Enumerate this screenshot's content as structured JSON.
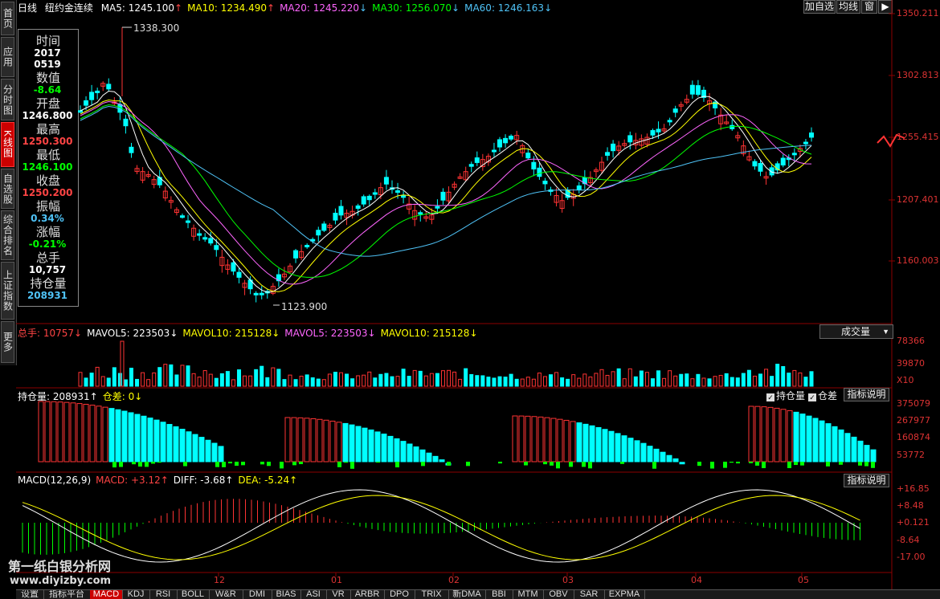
{
  "header": {
    "period": "日线",
    "instrument": "纽约金连续",
    "ma": [
      {
        "label": "MA5: 1245.100",
        "arrow": "↑",
        "color": "#ffffff"
      },
      {
        "label": "MA10: 1234.490",
        "arrow": "↑",
        "color": "#ffff00"
      },
      {
        "label": "MA20: 1245.220",
        "arrow": "↓",
        "color": "#ff66ff"
      },
      {
        "label": "MA30: 1256.070",
        "arrow": "↓",
        "color": "#00ff00"
      },
      {
        "label": "MA60: 1246.163",
        "arrow": "↓",
        "color": "#4fc3f7"
      }
    ],
    "buttons": {
      "add_watch": "加自选",
      "average": "均线",
      "window": "窗"
    }
  },
  "leftnav": [
    {
      "label": "首页",
      "active": false
    },
    {
      "label": "应用",
      "active": false
    },
    {
      "label": "分时图",
      "active": false
    },
    {
      "label": "K线图",
      "active": true
    },
    {
      "label": "自选股",
      "active": false
    },
    {
      "label": "综合排名",
      "active": false
    },
    {
      "label": "上证指数",
      "active": false
    },
    {
      "label": "更多",
      "active": false
    }
  ],
  "infobox": {
    "time_label": "时间",
    "year": "2017",
    "date": "0519",
    "value_label": "数值",
    "value": "-8.64",
    "open_label": "开盘",
    "open": "1246.800",
    "high_label": "最高",
    "high": "1250.300",
    "low_label": "最低",
    "low": "1246.100",
    "close_label": "收盘",
    "close": "1250.200",
    "amplitude_label": "振幅",
    "amplitude": "0.34%",
    "change_label": "涨幅",
    "change": "-0.21%",
    "volume_label": "总手",
    "volume": "10,757",
    "oi_label": "持仓量",
    "oi": "208931"
  },
  "price_axis": {
    "ticks": [
      "1350.211",
      "1302.813",
      "1255.415",
      "1207.401",
      "1160.003"
    ]
  },
  "annotations": {
    "max": "1338.300",
    "min": "1123.900"
  },
  "volume_panel": {
    "header": [
      {
        "text": "总手: 10757",
        "arrow": "↓",
        "color": "#ff4444"
      },
      {
        "text": "MAVOL5: 223503",
        "arrow": "↓",
        "color": "#ffffff"
      },
      {
        "text": "MAVOL10: 215128",
        "arrow": "↓",
        "color": "#ffff00"
      },
      {
        "text": "MAVOL5: 223503",
        "arrow": "↓",
        "color": "#ff66ff"
      },
      {
        "text": "MAVOL10: 215128",
        "arrow": "↓",
        "color": "#ffff00"
      }
    ],
    "selector": "成交量",
    "ticks": [
      "78366",
      "39870"
    ],
    "unit": "X10"
  },
  "oi_panel": {
    "header": [
      {
        "text": "持仓量: 208931",
        "arrow": "↑",
        "color": "#ffffff"
      },
      {
        "text": "仓差: 0",
        "arrow": "↓",
        "color": "#ffff00"
      }
    ],
    "check_oi": "持仓量",
    "check_diff": "仓差",
    "help": "指标说明",
    "ticks": [
      "375079",
      "267977",
      "160874",
      "53772"
    ]
  },
  "macd_panel": {
    "header": [
      {
        "text": "MACD(12,26,9)",
        "arrow": "",
        "color": "#ffffff"
      },
      {
        "text": "MACD: +3.12",
        "arrow": "↑",
        "color": "#ff4444"
      },
      {
        "text": "DIFF: -3.68",
        "arrow": "↑",
        "color": "#ffffff"
      },
      {
        "text": "DEA: -5.24",
        "arrow": "↑",
        "color": "#ffff00"
      }
    ],
    "help": "指标说明",
    "ticks": [
      "+16.85",
      "+8.48",
      "+0.121",
      "-8.64",
      "-17.00"
    ]
  },
  "x_axis": {
    "labels": [
      "12",
      "01",
      "02",
      "03",
      "04",
      "05"
    ]
  },
  "watermark": {
    "line1": "第一纸白银分析网",
    "line2": "www.diyizby.com"
  },
  "tabs": [
    {
      "label": "设置",
      "active": false
    },
    {
      "label": "指标平台",
      "active": false
    },
    {
      "label": "MACD",
      "active": true
    },
    {
      "label": "KDJ",
      "active": false
    },
    {
      "label": "RSI",
      "active": false
    },
    {
      "label": "BOLL",
      "active": false
    },
    {
      "label": "W&R",
      "active": false
    },
    {
      "label": "DMI",
      "active": false
    },
    {
      "label": "BIAS",
      "active": false
    },
    {
      "label": "ASI",
      "active": false
    },
    {
      "label": "VR",
      "active": false
    },
    {
      "label": "ARBR",
      "active": false
    },
    {
      "label": "DPO",
      "active": false
    },
    {
      "label": "TRIX",
      "active": false
    },
    {
      "label": "新DMA",
      "active": false
    },
    {
      "label": "BBI",
      "active": false
    },
    {
      "label": "MTM",
      "active": false
    },
    {
      "label": "OBV",
      "active": false
    },
    {
      "label": "SAR",
      "active": false
    },
    {
      "label": "EXPMA",
      "active": false
    }
  ],
  "colors": {
    "up": "#ff3333",
    "down": "#00ffff",
    "grid": "#8b0000",
    "axis_text": "#ff3333"
  }
}
